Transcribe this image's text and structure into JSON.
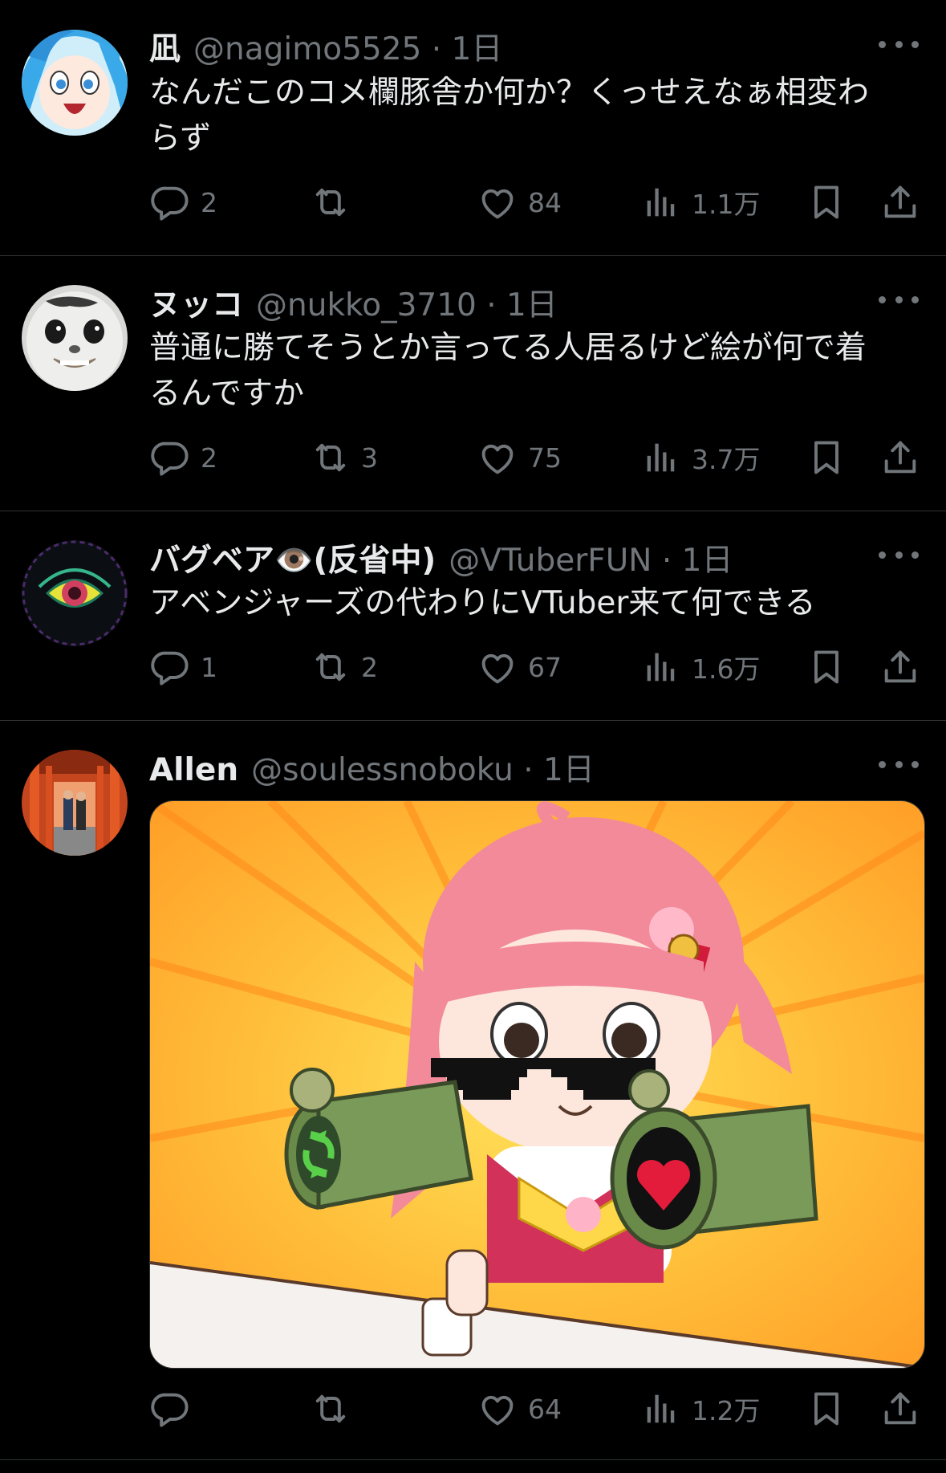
{
  "tweets": [
    {
      "name": "凪",
      "handle": "@nagimo5525",
      "time": "1日",
      "text": "なんだこのコメ欄豚舎か何か？くっせえなぁ相変わらず",
      "reply_count": "2",
      "retweet_count": "",
      "like_count": "84",
      "view_count": "1.1万"
    },
    {
      "name": "ヌッコ",
      "handle": "@nukko_3710",
      "time": "1日",
      "text": "普通に勝てそうとか言ってる人居るけど絵が何で着るんですか",
      "reply_count": "2",
      "retweet_count": "3",
      "like_count": "75",
      "view_count": "3.7万"
    },
    {
      "name": "バグベア👁️(反省中)",
      "handle": "@VTuberFUN",
      "time": "1日",
      "text": "アベンジャーズの代わりにVTuber来て何できる",
      "reply_count": "1",
      "retweet_count": "2",
      "like_count": "67",
      "view_count": "1.6万"
    },
    {
      "name": "Allen",
      "handle": "@soulessnoboku",
      "time": "1日",
      "text": "",
      "reply_count": "",
      "retweet_count": "",
      "like_count": "64",
      "view_count": "1.2万"
    }
  ],
  "icons": {
    "reply": "reply-icon",
    "retweet": "retweet-icon",
    "like": "heart-icon",
    "views": "views-icon",
    "bookmark": "bookmark-icon",
    "share": "share-icon",
    "more": "more-icon"
  },
  "colors": {
    "background": "#000000",
    "text": "#e7e9ea",
    "secondary": "#71767b",
    "divider": "#2f3336"
  }
}
